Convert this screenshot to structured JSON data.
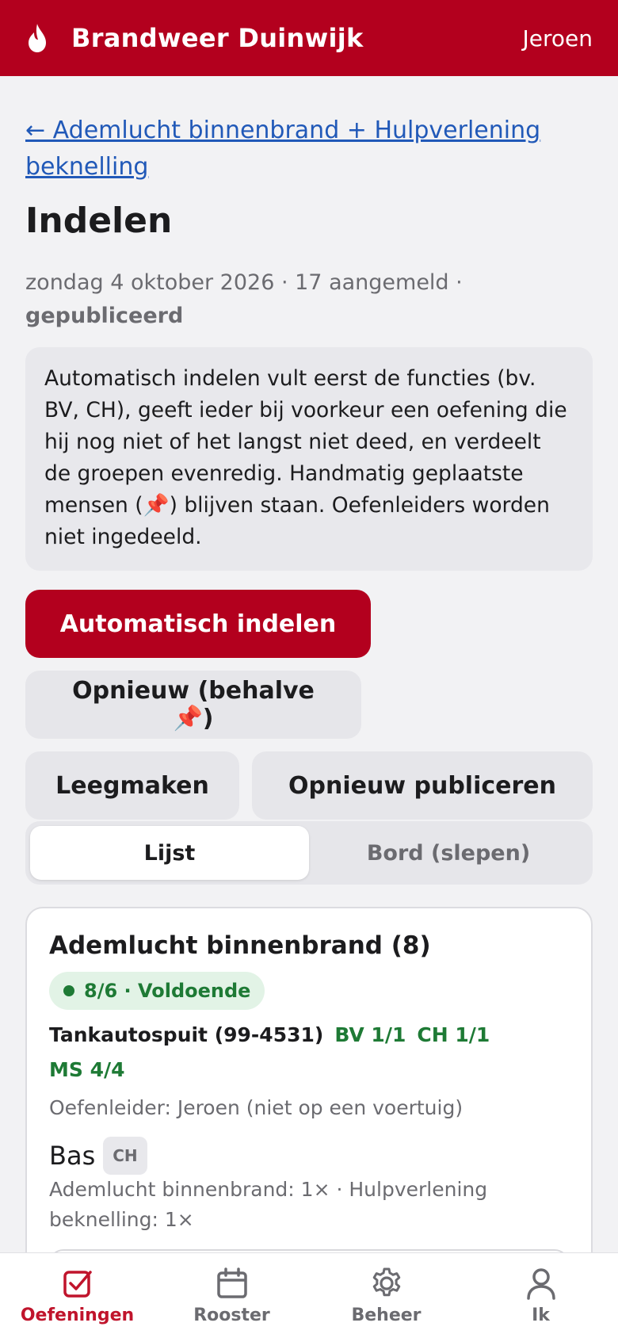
{
  "app": {
    "brand": "Brandweer Duinwijk",
    "user": "Jeroen",
    "accent_color": "#b3001e"
  },
  "page": {
    "back_link": "← Ademlucht binnenbrand + Hulpverlening beknelling",
    "title": "Indelen",
    "meta_text": "zondag 4 oktober 2026 · 17 aangemeld · ",
    "meta_status": "gepubliceerd",
    "info_text": "Automatisch indelen vult eerst de functies (bv. BV, CH), geeft ieder bij voorkeur een oefening die hij nog niet of het langst niet deed, en verdeelt de groepen evenredig. Handmatig geplaatste mensen (📌) blijven staan. Oefenleiders worden niet ingedeeld."
  },
  "actions": {
    "auto_assign": "Automatisch indelen",
    "redo_except_pinned": "Opnieuw (behalve 📌)",
    "clear": "Leegmaken",
    "republish": "Opnieuw publiceren"
  },
  "view_toggle": {
    "list": "Lijst",
    "board": "Bord (slepen)",
    "selected": "Lijst"
  },
  "group": {
    "title": "Ademlucht binnenbrand (8)",
    "status_pill": "8/6 · Voldoende",
    "status_color": "#1e7a35",
    "vehicle": "Tankautospuit (99-4531)",
    "roles": [
      "BV 1/1",
      "CH 1/1",
      "MS 4/4"
    ],
    "oefenleider": "Oefenleider: Jeroen (niet op een voertuig)",
    "person": {
      "name": "Bas",
      "role_badge": "CH",
      "history": "Ademlucht binnenbrand: 1× · Hulpverlening beknelling: 1×"
    }
  },
  "bottom_nav": {
    "items": [
      {
        "label": "Oefeningen",
        "icon": "checkbox-icon",
        "active": true
      },
      {
        "label": "Rooster",
        "icon": "calendar-icon",
        "active": false
      },
      {
        "label": "Beheer",
        "icon": "gear-icon",
        "active": false
      },
      {
        "label": "Ik",
        "icon": "person-icon",
        "active": false
      }
    ]
  }
}
